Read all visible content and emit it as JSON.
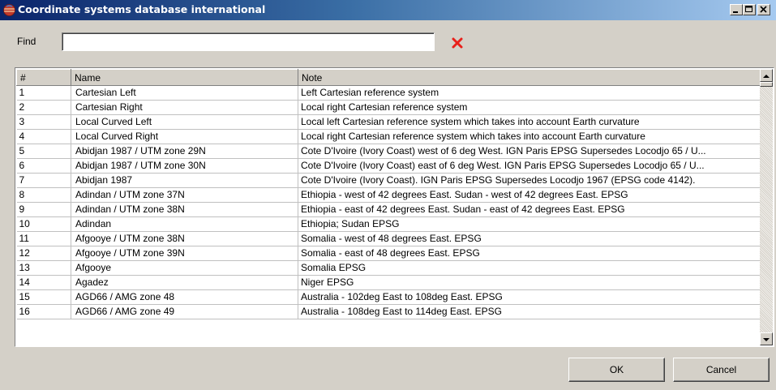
{
  "window": {
    "title": "Coordinate systems database international",
    "icon": "globe-icon",
    "controls": [
      "minimize-icon",
      "maximize-icon",
      "close-icon"
    ]
  },
  "find": {
    "label": "Find",
    "value": "",
    "clear_icon": "clear-x-icon",
    "clear_color": "#e8201a"
  },
  "table": {
    "columns": [
      "#",
      "Name",
      "Note"
    ],
    "rows": [
      {
        "num": "1",
        "name": "Cartesian Left",
        "note": "Left Cartesian reference system"
      },
      {
        "num": "2",
        "name": "Cartesian Right",
        "note": "Local right Cartesian reference system"
      },
      {
        "num": "3",
        "name": "Local Curved Left",
        "note": "Local left Cartesian reference system which takes into account Earth curvature"
      },
      {
        "num": "4",
        "name": "Local Curved Right",
        "note": "Local right Cartesian reference system which takes into account Earth curvature"
      },
      {
        "num": "5",
        "name": "Abidjan 1987 / UTM zone 29N",
        "note": "Cote D'Ivoire (Ivory Coast) west of 6 deg West. IGN Paris EPSG Supersedes Locodjo 65 / U..."
      },
      {
        "num": "6",
        "name": "Abidjan 1987 / UTM zone 30N",
        "note": "Cote D'Ivoire (Ivory Coast) east of 6 deg West. IGN Paris EPSG Supersedes Locodjo 65 / U..."
      },
      {
        "num": "7",
        "name": "Abidjan 1987",
        "note": "Cote D'Ivoire (Ivory Coast). IGN Paris EPSG Supersedes Locodjo 1967 (EPSG code 4142)."
      },
      {
        "num": "8",
        "name": "Adindan / UTM zone 37N",
        "note": "Ethiopia - west of 42 degrees East.  Sudan - west of 42 degrees East. EPSG"
      },
      {
        "num": "9",
        "name": "Adindan / UTM zone 38N",
        "note": "Ethiopia - east of 42 degrees East.  Sudan - east of 42 degrees East. EPSG"
      },
      {
        "num": "10",
        "name": "Adindan",
        "note": "Ethiopia; Sudan EPSG"
      },
      {
        "num": "11",
        "name": "Afgooye / UTM zone 38N",
        "note": "Somalia - west of 48 degrees East. EPSG"
      },
      {
        "num": "12",
        "name": "Afgooye / UTM zone 39N",
        "note": "Somalia - east of 48 degrees East. EPSG"
      },
      {
        "num": "13",
        "name": "Afgooye",
        "note": "Somalia EPSG"
      },
      {
        "num": "14",
        "name": "Agadez",
        "note": "Niger EPSG"
      },
      {
        "num": "15",
        "name": "AGD66 / AMG zone 48",
        "note": "Australia - 102deg East to 108deg East. EPSG"
      },
      {
        "num": "16",
        "name": "AGD66 / AMG zone 49",
        "note": "Australia - 108deg East to 114deg East. EPSG"
      }
    ]
  },
  "buttons": {
    "ok": "OK",
    "cancel": "Cancel"
  }
}
